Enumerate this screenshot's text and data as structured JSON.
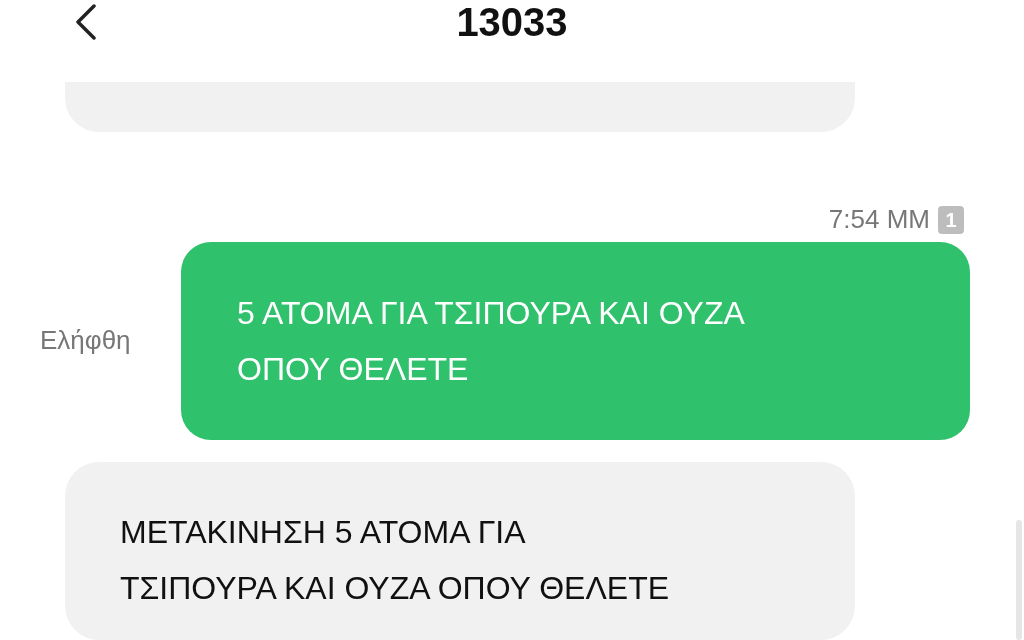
{
  "header": {
    "title": "13033"
  },
  "messages": [
    {
      "kind": "incoming"
    },
    {
      "kind": "outgoing",
      "time": "7:54 ΜΜ",
      "sim": "1",
      "status": "Ελήφθη",
      "lines": [
        "5 ΑΤΟΜΑ ΓΙΑ ΤΣΙΠΟΥΡΑ ΚΑΙ ΟΥΖΑ",
        "ΟΠΟΥ ΘΕΛΕΤΕ"
      ]
    },
    {
      "kind": "incoming",
      "lines": [
        "ΜΕΤΑΚΙΝΗΣΗ 5 ΑΤΟΜΑ ΓΙΑ",
        "ΤΣΙΠΟΥΡΑ ΚΑΙ ΟΥΖΑ ΟΠΟΥ ΘΕΛΕΤΕ"
      ]
    }
  ]
}
